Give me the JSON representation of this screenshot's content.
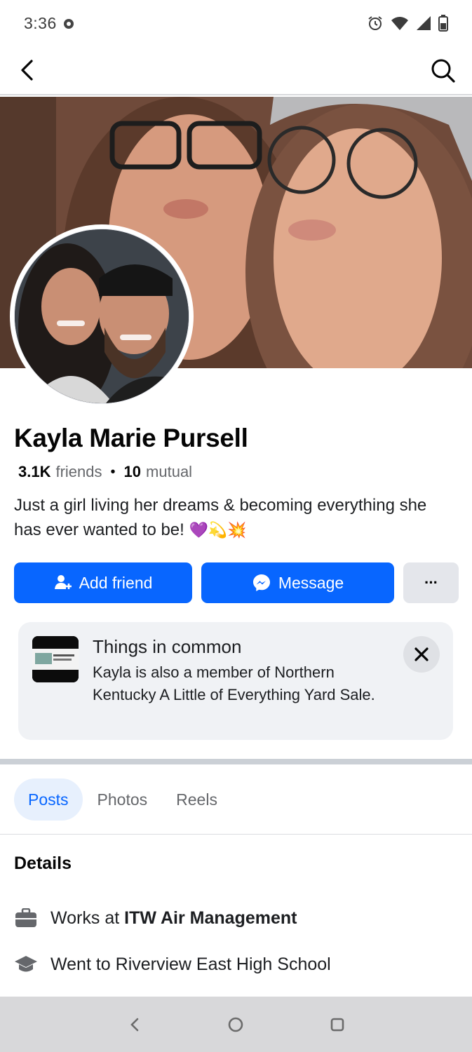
{
  "status_bar": {
    "time": "3:36",
    "icons": [
      "alarm-icon",
      "wifi-icon",
      "cell-signal-icon",
      "battery-icon"
    ]
  },
  "nav": {
    "back_icon": "back-arrow-icon",
    "search_icon": "search-icon"
  },
  "profile": {
    "name": "Kayla Marie Pursell",
    "friends_count": "3.1K",
    "friends_label": "friends",
    "separator": "•",
    "mutual_count": "10",
    "mutual_label": "mutual",
    "bio_text": "Just a girl living her dreams & becoming everything she has ever wanted to be!",
    "bio_emojis": "💜💫💥"
  },
  "actions": {
    "add_friend": "Add friend",
    "message": "Message",
    "more": "···"
  },
  "things_in_common": {
    "title": "Things in common",
    "text": "Kayla is also a member of Northern Kentucky A Little of Everything Yard Sale."
  },
  "tabs": [
    {
      "label": "Posts",
      "active": true
    },
    {
      "label": "Photos",
      "active": false
    },
    {
      "label": "Reels",
      "active": false
    }
  ],
  "details": {
    "title": "Details",
    "work_prefix": "Works at",
    "work_place": "ITW Air Management",
    "school": "Went to Riverview East High School"
  },
  "colors": {
    "primary": "#0866ff",
    "tab_active_bg": "#e7f0fd",
    "card_bg": "#f0f2f5"
  }
}
